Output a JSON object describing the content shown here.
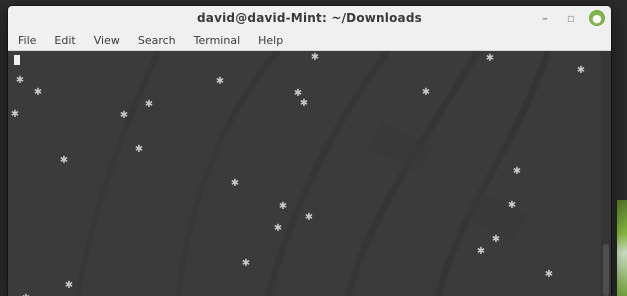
{
  "window": {
    "title": "david@david-Mint: ~/Downloads",
    "controls": {
      "minimize": "–",
      "maximize": "▫",
      "close": "●"
    }
  },
  "menu": {
    "items": [
      "File",
      "Edit",
      "View",
      "Search",
      "Terminal",
      "Help"
    ]
  },
  "terminal": {
    "bg": "#3b3b3b",
    "cursor_color": "#f0f0f0"
  },
  "icons": {
    "star_glyph": "✱"
  },
  "colors": {
    "titlebar_bg": "#f0f0f0",
    "menubar_bg": "#f0f0f0",
    "close_bg": "#83b54c"
  }
}
